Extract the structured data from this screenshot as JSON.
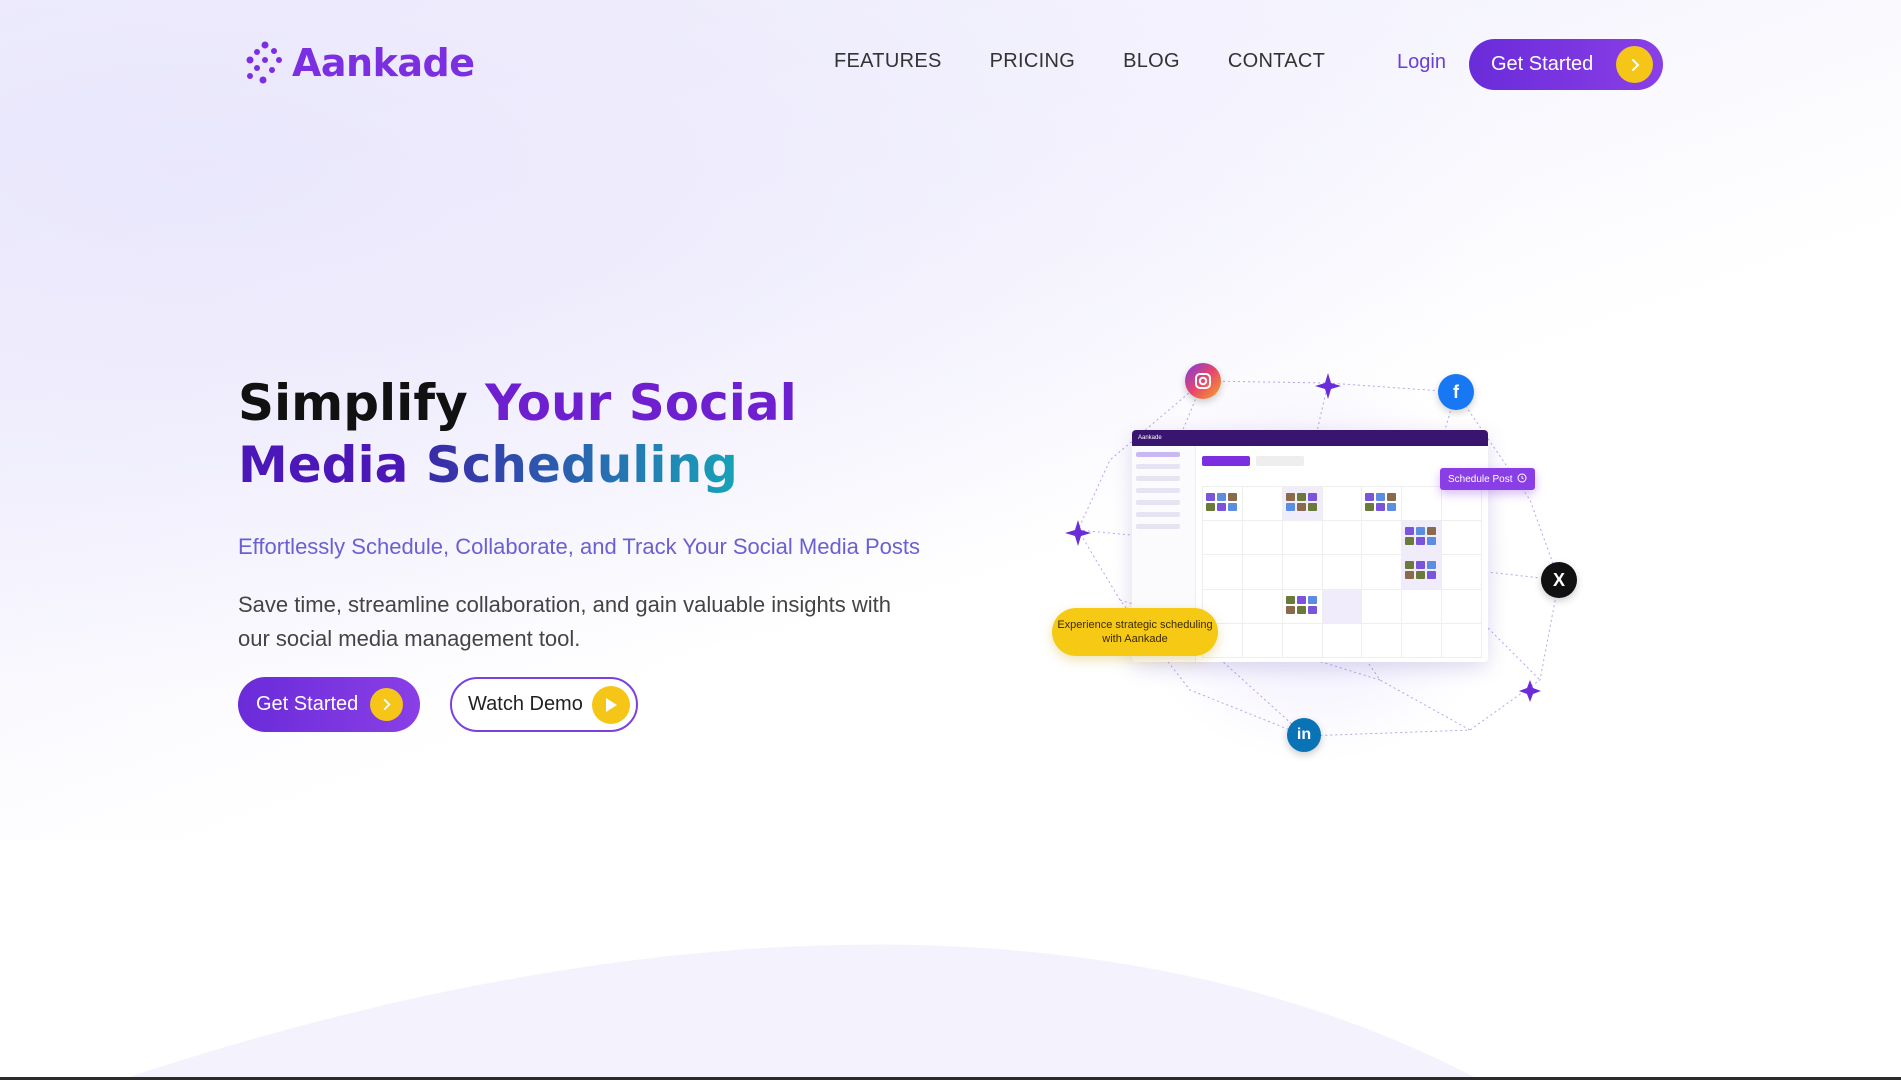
{
  "brand": {
    "name": "Aankade",
    "accent": "#7c2fe0",
    "cta_yellow": "#f5c518"
  },
  "nav": {
    "items": [
      "FEATURES",
      "PRICING",
      "BLOG",
      "CONTACT"
    ]
  },
  "header": {
    "login": "Login",
    "cta": "Get Started"
  },
  "hero": {
    "title_part1": "Simplify ",
    "title_part2": "Your Social",
    "title_part3": "Media ",
    "title_part4": "Scheduling",
    "subtitle": "Effortlessly Schedule, Collaborate, and Track Your Social Media Posts",
    "description": "Save time, streamline collaboration, and gain valuable insights with our social media management tool.",
    "cta_primary": "Get Started",
    "cta_secondary": "Watch Demo"
  },
  "illustration": {
    "schedule_button": "Schedule Post",
    "callout": "Experience strategic scheduling with Aankade",
    "app_logo": "Aankade",
    "social_icons": [
      "instagram-icon",
      "facebook-icon",
      "x-icon",
      "linkedin-icon"
    ]
  }
}
